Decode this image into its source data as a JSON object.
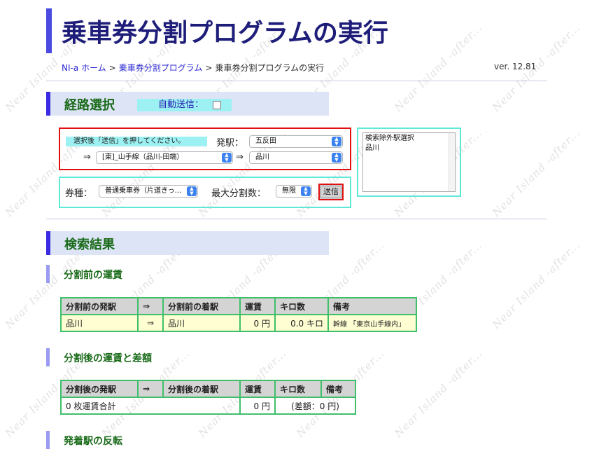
{
  "watermark": "Near Island -after...",
  "page_title": "乗車券分割プログラムの実行",
  "breadcrumb": {
    "home": "NI-a ホーム",
    "parent": "乗車券分割プログラム",
    "current": "乗車券分割プログラムの実行",
    "sep": ">"
  },
  "version": "ver. 12.81",
  "route_section": {
    "title": "経路選択",
    "auto_send_label": "自動送信：",
    "auto_send_checked": false,
    "hint": "選択後「送信」を押してください。",
    "departure_label": "発駅：",
    "departure_value": "五反田",
    "arrow": "⇒",
    "line_value": "[東]_山手線（品川-田端）",
    "dest_value": "品川",
    "ticket_label": "券種：",
    "ticket_value": "普通乗車券（片道きっ…",
    "max_split_label": "最大分割数：",
    "max_split_value": "無限",
    "submit_label": "送信",
    "exclude_title": "検索除外駅選択",
    "exclude_items": [
      "品川"
    ]
  },
  "results_section": {
    "title": "検索結果",
    "before": {
      "title": "分割前の運賃",
      "headers": [
        "分割前の発駅",
        "⇒",
        "分割前の着駅",
        "運賃",
        "キロ数",
        "備考"
      ],
      "row": [
        "品川",
        "⇒",
        "品川",
        "0 円",
        "0.0 キロ",
        "幹線 「東京山手線内」"
      ]
    },
    "after": {
      "title": "分割後の運賃と差額",
      "headers": [
        "分割後の発駅",
        "⇒",
        "分割後の着駅",
        "運賃",
        "キロ数",
        "備考"
      ],
      "total_label": "0 枚運賃合計",
      "total_fare": "0 円",
      "diff": "(差額：0 円)"
    },
    "reverse_title": "発着駅の反転"
  },
  "colors": {
    "title_text": "#1e1e7a",
    "accent_bar": "#4a4ae0",
    "section_text": "#1a6b1a",
    "section_bg": "#dde4f6",
    "highlight_cyan": "#9df1f3",
    "red_border": "#e01010",
    "table_border": "#3fbf6a",
    "row_yellow": "#fffed2",
    "select_chevron": "#3b82f0"
  },
  "icons": [
    "chevron-updown-icon",
    "checkbox-icon"
  ]
}
